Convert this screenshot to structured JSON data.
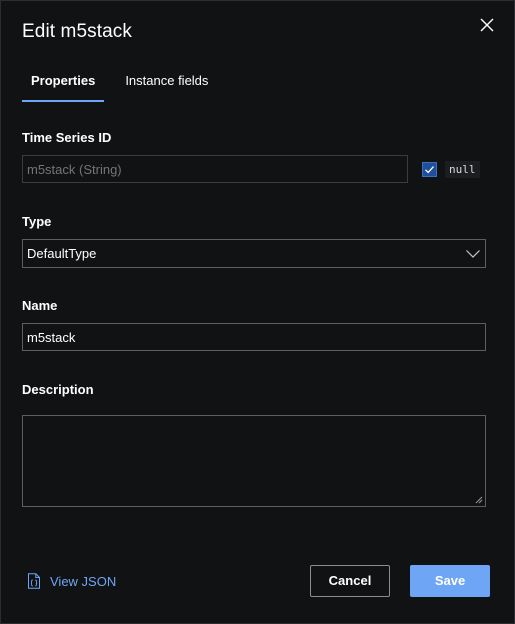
{
  "dialog": {
    "title": "Edit m5stack",
    "close_icon": "close-icon"
  },
  "tabs": [
    {
      "label": "Properties",
      "active": true
    },
    {
      "label": "Instance fields",
      "active": false
    }
  ],
  "fields": {
    "time_series_id": {
      "label": "Time Series ID",
      "placeholder": "m5stack (String)",
      "value": "",
      "disabled": true,
      "null_checked": true,
      "null_badge": "null"
    },
    "type": {
      "label": "Type",
      "selected": "DefaultType",
      "icon": "chevron-down-icon"
    },
    "name": {
      "label": "Name",
      "value": "m5stack"
    },
    "description": {
      "label": "Description",
      "value": ""
    }
  },
  "footer": {
    "view_json_label": "View JSON",
    "view_json_icon": "json-file-icon",
    "cancel_label": "Cancel",
    "save_label": "Save"
  },
  "colors": {
    "background": "#111214",
    "accent": "#6ea6f5",
    "checkbox": "#1f4f9b",
    "border": "#5b5e63"
  }
}
